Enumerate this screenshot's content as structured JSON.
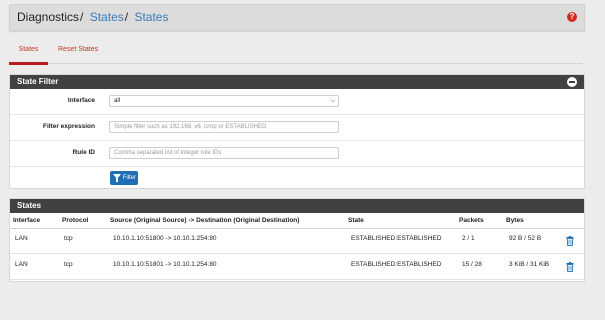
{
  "breadcrumb": {
    "root": "Diagnostics",
    "section": "States",
    "current": "States"
  },
  "tabs": [
    {
      "label": "States",
      "active": true
    },
    {
      "label": "Reset States",
      "active": false
    }
  ],
  "filter_panel": {
    "title": "State Filter",
    "interface_label": "Interface",
    "interface_value": "all",
    "expression_label": "Filter expression",
    "expression_placeholder": "Simple filter such as 192.168, v6, icmp or ESTABLISHED",
    "ruleid_label": "Rule ID",
    "ruleid_placeholder": "Comma separated list of integer rule IDs",
    "button_label": "Filter"
  },
  "states_panel": {
    "title": "States",
    "columns": [
      "Interface",
      "Protocol",
      "Source (Original Source) -> Destination (Original Destination)",
      "State",
      "Packets",
      "Bytes"
    ],
    "rows": [
      {
        "interface": "LAN",
        "protocol": "tcp",
        "flow": "10.10.1.10:51800 -> 10.10.1.254:80",
        "state": "ESTABLISHED:ESTABLISHED",
        "packets": "2 / 1",
        "bytes": "92 B / 52 B"
      },
      {
        "interface": "LAN",
        "protocol": "tcp",
        "flow": "10.10.1.10:51801 -> 10.10.1.254:80",
        "state": "ESTABLISHED:ESTABLISHED",
        "packets": "15 / 28",
        "bytes": "3 KiB / 31 KiB"
      }
    ]
  },
  "icons": {
    "help": "question-circle-icon",
    "collapse": "minus-circle-icon",
    "filter": "funnel-icon",
    "delete": "trash-icon"
  },
  "colors": {
    "accent_red": "#b41e1e",
    "link_blue": "#3a7ab8",
    "button_blue": "#1e6fb5",
    "panel_heading": "#414141",
    "trash_blue": "#1e6fb5"
  }
}
